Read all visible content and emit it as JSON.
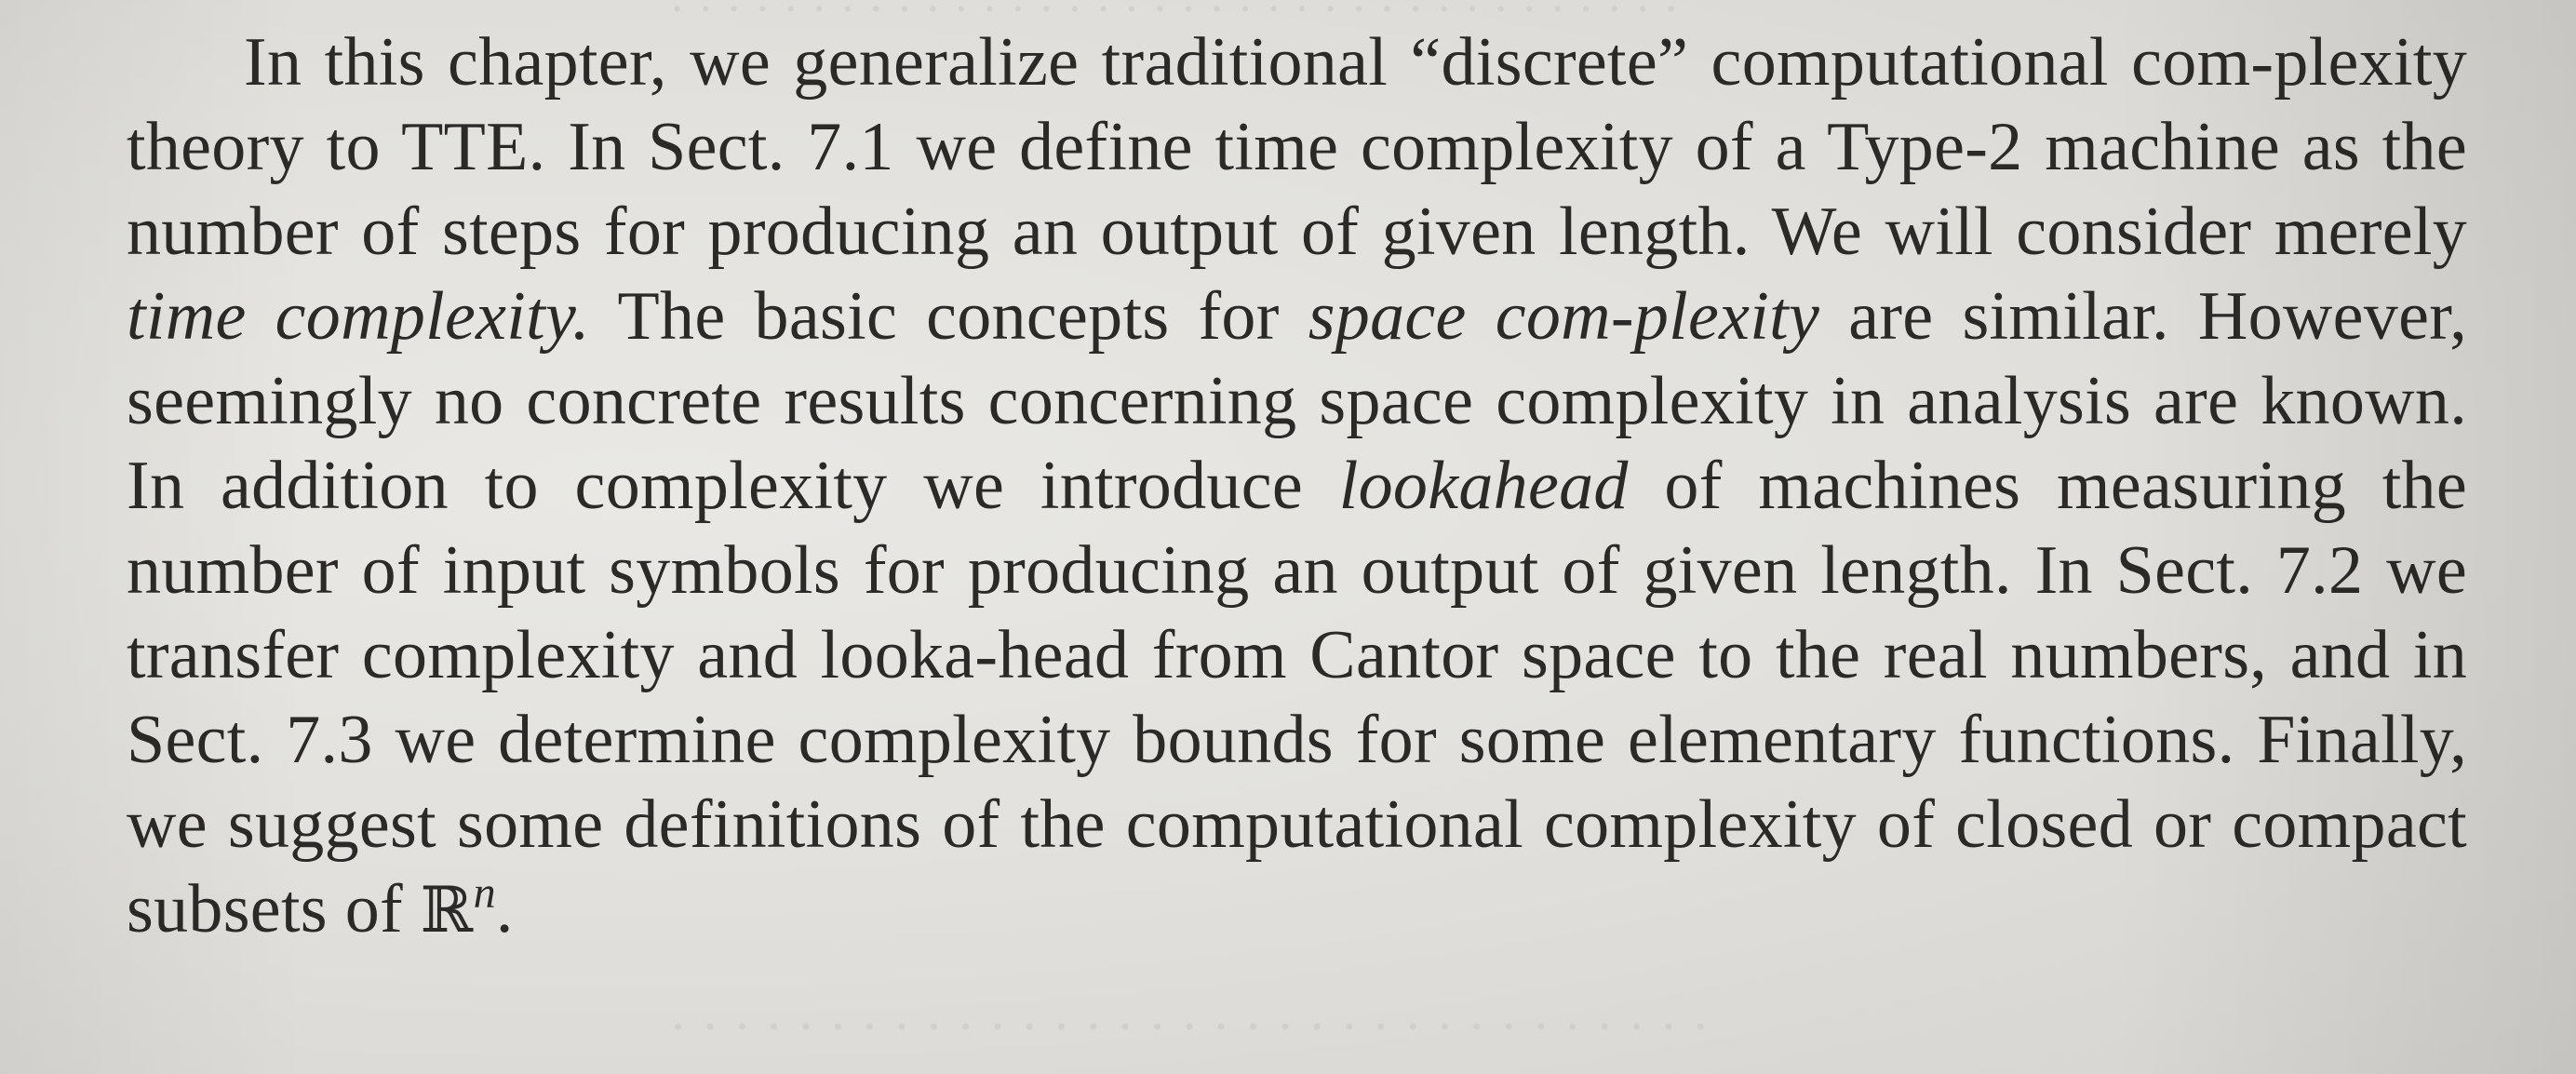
{
  "paragraph": {
    "s1": "In this chapter, we generalize traditional “discrete” computational com-plexity theory to TTE. In Sect. 7.1 we define time complexity of a Type-2 machine as the number of steps for producing an output of given length. We will consider merely ",
    "term_time": "time complexity.",
    "s2": " The basic concepts for ",
    "term_space": "space com-plexity",
    "s3": " are similar. However, seemingly no concrete results concerning space complexity in analysis are known. In addition to complexity we introduce ",
    "term_lookahead": "lookahead",
    "s4": " of machines measuring the number of input symbols for producing an output of given length. In Sect. 7.2 we transfer complexity and looka-head from Cantor space to the real numbers, and in Sect. 7.3 we determine complexity bounds for some elementary functions. Finally, we suggest some definitions of the computational complexity of closed or compact subsets of ",
    "math_base": "ℝ",
    "math_exp": "n",
    "end": "."
  }
}
